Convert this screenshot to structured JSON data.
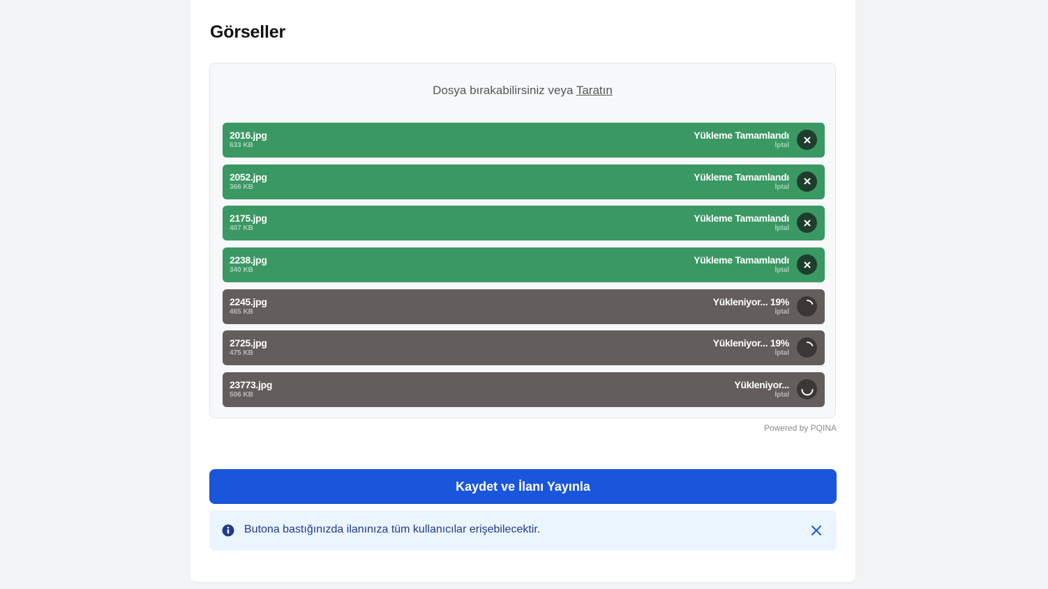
{
  "section": {
    "title": "Görseller"
  },
  "dropzone": {
    "label_prefix": "Dosya bırakabilirsiniz veya ",
    "browse_label": "Taratın",
    "powered_by": "Powered by PQINA"
  },
  "files": [
    {
      "name": "2016.jpg",
      "size": "633 KB",
      "status": "Yükleme Tamamlandı",
      "cancel": "İptal",
      "state": "complete",
      "action_icon": "close-icon"
    },
    {
      "name": "2052.jpg",
      "size": "366 KB",
      "status": "Yükleme Tamamlandı",
      "cancel": "İptal",
      "state": "complete",
      "action_icon": "close-icon"
    },
    {
      "name": "2175.jpg",
      "size": "407 KB",
      "status": "Yükleme Tamamlandı",
      "cancel": "İptal",
      "state": "complete",
      "action_icon": "close-icon"
    },
    {
      "name": "2238.jpg",
      "size": "340 KB",
      "status": "Yükleme Tamamlandı",
      "cancel": "İptal",
      "state": "complete",
      "action_icon": "close-icon"
    },
    {
      "name": "2245.jpg",
      "size": "465 KB",
      "status": "Yükleniyor... 19%",
      "cancel": "İptal",
      "state": "uploading",
      "progress": 0.19,
      "action_icon": "progress-spinner-icon"
    },
    {
      "name": "2725.jpg",
      "size": "475 KB",
      "status": "Yükleniyor... 19%",
      "cancel": "İptal",
      "state": "uploading",
      "progress": 0.19,
      "action_icon": "progress-spinner-icon"
    },
    {
      "name": "23773.jpg",
      "size": "506 KB",
      "status": "Yükleniyor...",
      "cancel": "İptal",
      "state": "uploading",
      "action_icon": "loading-spinner-icon"
    }
  ],
  "actions": {
    "publish_label": "Kaydet ve İlanı Yayınla"
  },
  "alert": {
    "text": "Butona bastığınızda ilanınıza tüm kullanıcılar erişebilecektir.",
    "icon": "info-icon",
    "close_icon": "close-icon"
  },
  "colors": {
    "page_bg": "#f1f3f5",
    "complete": "#3a9863",
    "uploading": "#635e5b",
    "primary": "#1a56db",
    "alert_bg": "#ebf5ff",
    "alert_text": "#1e3a8a"
  }
}
